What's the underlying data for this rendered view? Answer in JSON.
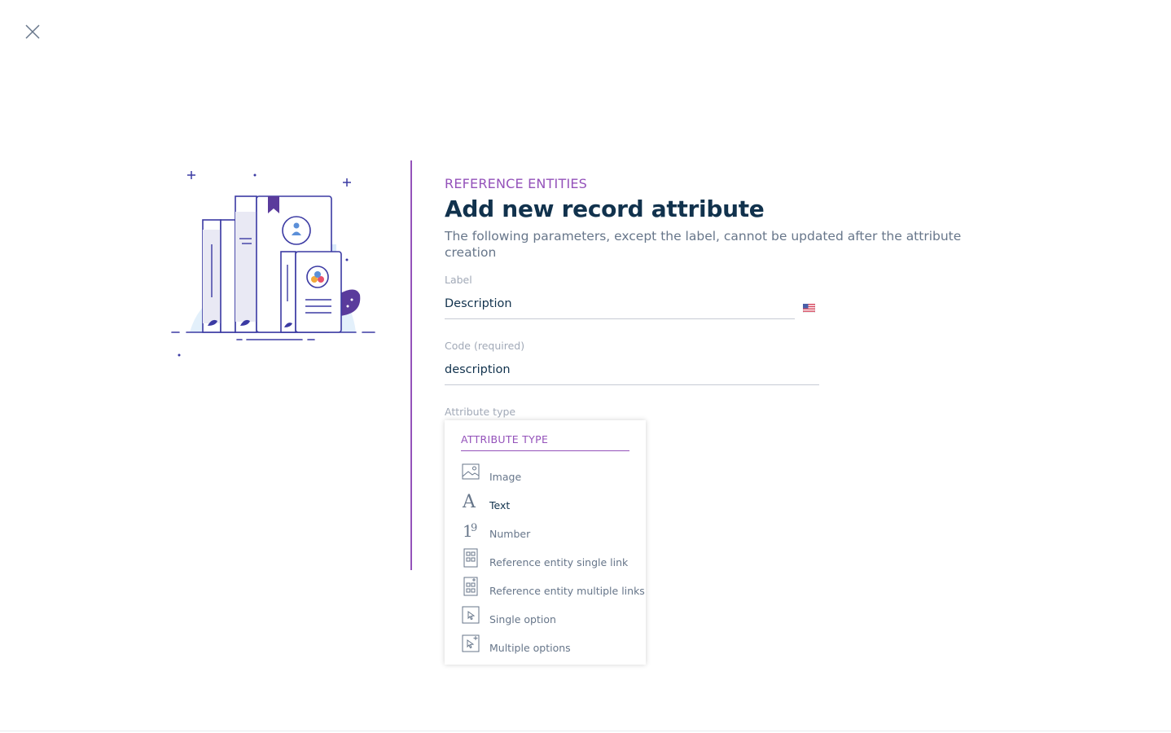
{
  "header": {
    "close_icon": "close-icon"
  },
  "illustration": {
    "icon": "reference-entities-illustration"
  },
  "form": {
    "subtitle": "REFERENCE ENTITIES",
    "title": "Add new record attribute",
    "description": "The following parameters, except the label, cannot be updated after the attribute creation",
    "label_field": {
      "label": "Label",
      "value": "Description",
      "locale_icon": "us-flag-icon"
    },
    "code_field": {
      "label": "Code (required)",
      "value": "description"
    },
    "type_field": {
      "label": "Attribute type"
    }
  },
  "dropdown": {
    "header": "ATTRIBUTE TYPE",
    "options": [
      {
        "label": "Image",
        "icon": "image-icon"
      },
      {
        "label": "Text",
        "icon": "text-icon",
        "selected": true
      },
      {
        "label": "Number",
        "icon": "number-icon"
      },
      {
        "label": "Reference entity single link",
        "icon": "record-link-icon"
      },
      {
        "label": "Reference entity multiple links",
        "icon": "record-multiple-links-icon"
      },
      {
        "label": "Single option",
        "icon": "single-option-icon"
      },
      {
        "label": "Multiple options",
        "icon": "multiple-options-icon"
      }
    ]
  },
  "colors": {
    "accent": "#9452ba",
    "text_dark": "#11324d",
    "text_grey": "#67768a",
    "label_grey": "#a1a9b7"
  }
}
